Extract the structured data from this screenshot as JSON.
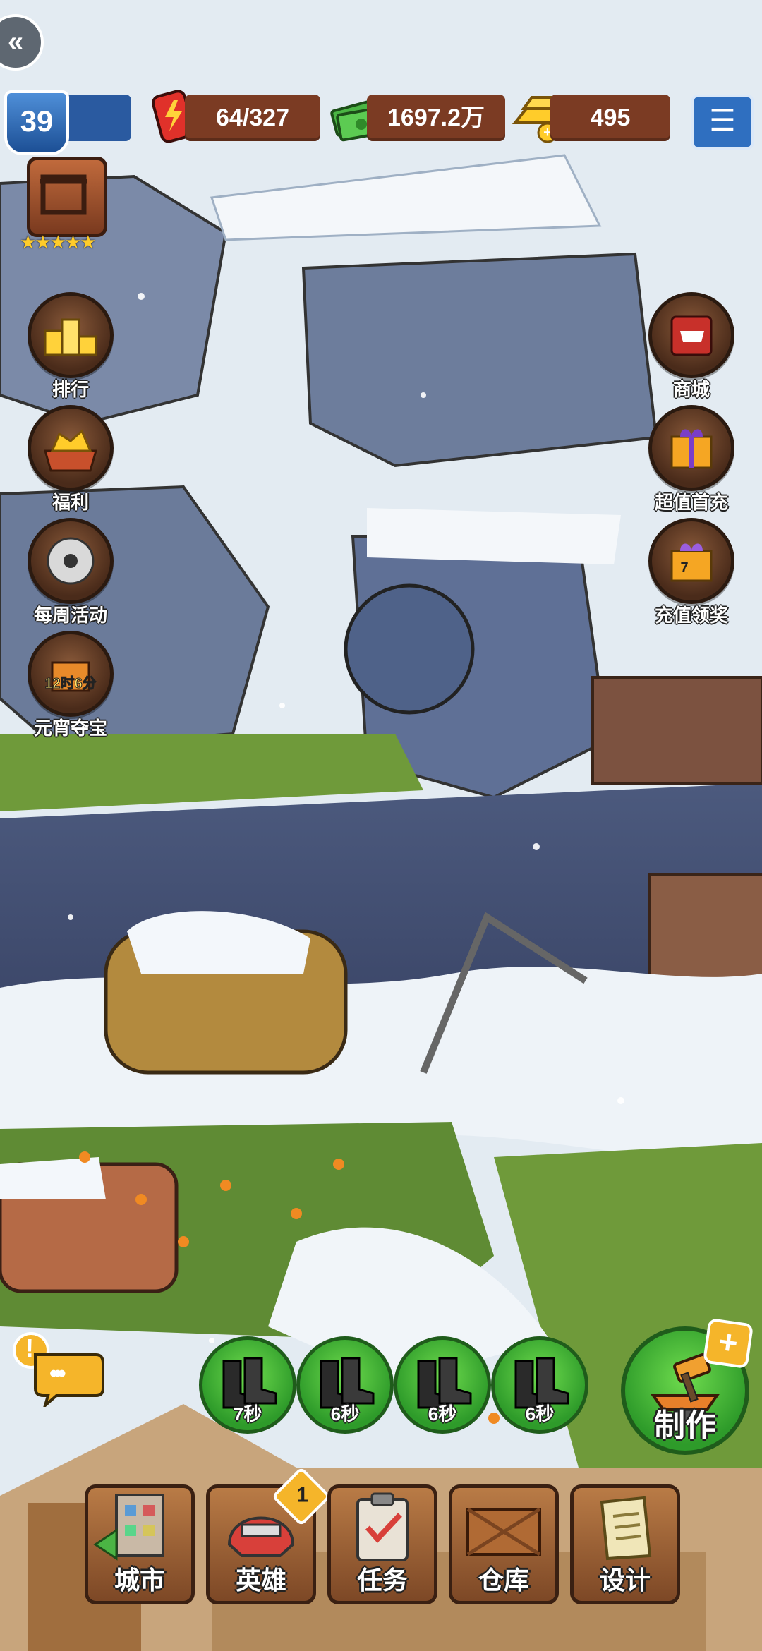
{
  "player": {
    "level": "39"
  },
  "resources": {
    "energy": "64/327",
    "cash": "1697.2万",
    "gold": "495"
  },
  "rank": {
    "stars": "★★★★★"
  },
  "left_menu": [
    {
      "label": "排行",
      "icon": "trophy-podium-icon"
    },
    {
      "label": "福利",
      "icon": "gold-treasure-icon"
    },
    {
      "label": "每周活动",
      "icon": "hazmat-suit-icon"
    },
    {
      "label": "元宵夺宝",
      "icon": "lantern-treasure-icon",
      "timer": "12时6分"
    }
  ],
  "right_menu": [
    {
      "label": "商城",
      "icon": "shop-icon"
    },
    {
      "label": "超值首充",
      "icon": "gift-box-icon"
    },
    {
      "label": "充值领奖",
      "icon": "reward-gift-icon",
      "badge": "7"
    }
  ],
  "production": [
    {
      "time": "7秒",
      "icon": "boots-icon"
    },
    {
      "time": "6秒",
      "icon": "boots-icon"
    },
    {
      "time": "6秒",
      "icon": "boots-icon"
    },
    {
      "time": "6秒",
      "icon": "boots-icon"
    }
  ],
  "craft": {
    "label": "制作",
    "plus": "+"
  },
  "chat": {
    "alert": "!",
    "dots": "•••"
  },
  "bottom_nav": [
    {
      "label": "城市",
      "icon": "city-icon"
    },
    {
      "label": "英雄",
      "icon": "hero-helmet-icon",
      "badge": "1"
    },
    {
      "label": "任务",
      "icon": "clipboard-task-icon"
    },
    {
      "label": "仓库",
      "icon": "warehouse-crate-icon"
    },
    {
      "label": "设计",
      "icon": "blueprint-icon"
    }
  ],
  "colors": {
    "snow": "#eef3f8",
    "grass": "#6f9a3a",
    "brown_button": "#7b3b23",
    "green_slot": "#3fb536",
    "blue_menu": "#2f6fc0"
  }
}
